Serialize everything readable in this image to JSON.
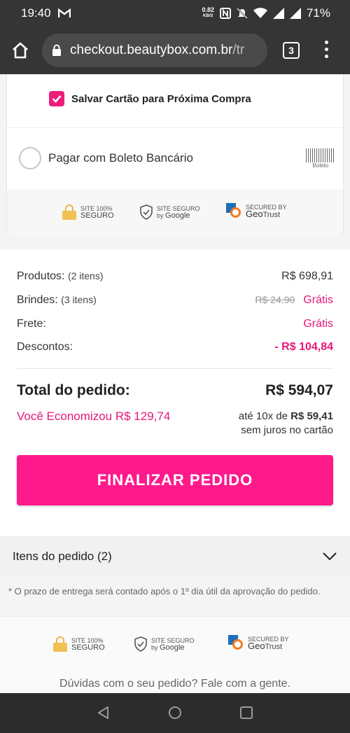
{
  "status_bar": {
    "time": "19:40",
    "net_speed": "0.82",
    "net_unit": "KB/S",
    "battery": "71%"
  },
  "browser": {
    "url_host": "checkout.beautybox.com.br",
    "url_path": "/tr",
    "tab_count": "3"
  },
  "payment": {
    "save_card_label": "Salvar Cartão para Próxima Compra",
    "save_card_checked": true,
    "boleto_label": "Pagar com Boleto Bancário",
    "boleto_icon_text": "Boleto"
  },
  "seals": {
    "site_safe_line1": "SITE 100%",
    "site_safe_line2": "SEGURO",
    "google_line1": "SITE SEGURO",
    "google_by": "by",
    "google_name": "Google",
    "geotrust_line1": "SECURED BY",
    "geotrust_geo": "Geo",
    "geotrust_trust": "Trust"
  },
  "summary": {
    "produtos_label": "Produtos:",
    "produtos_count": "(2 itens)",
    "produtos_value": "R$ 698,91",
    "brindes_label": "Brindes:",
    "brindes_count": "(3 itens)",
    "brindes_old_value": "R$ 24,90",
    "brindes_value": "Grátis",
    "frete_label": "Frete:",
    "frete_value": "Grátis",
    "descontos_label": "Descontos:",
    "descontos_value": "- R$ 104,84",
    "total_label": "Total do pedido:",
    "total_value": "R$ 594,07",
    "economy_text": "Você Economizou",
    "economy_value": "R$ 129,74",
    "installments_prefix": "até 10x de",
    "installments_value": "R$ 59,41",
    "installments_note": "sem juros no cartão",
    "finalize_button": "FINALIZAR PEDIDO"
  },
  "order_items": {
    "label": "Itens do pedido (2)"
  },
  "delivery_note": "* O prazo de entrega será contado após o 1º dia útil da aprovação do pedido.",
  "help_text": "Dúvidas com o seu pedido? Fale com a gente.",
  "colors": {
    "accent": "#ff1a8c",
    "pink_text": "#e6177a",
    "checkbox": "#ec1d7a"
  }
}
